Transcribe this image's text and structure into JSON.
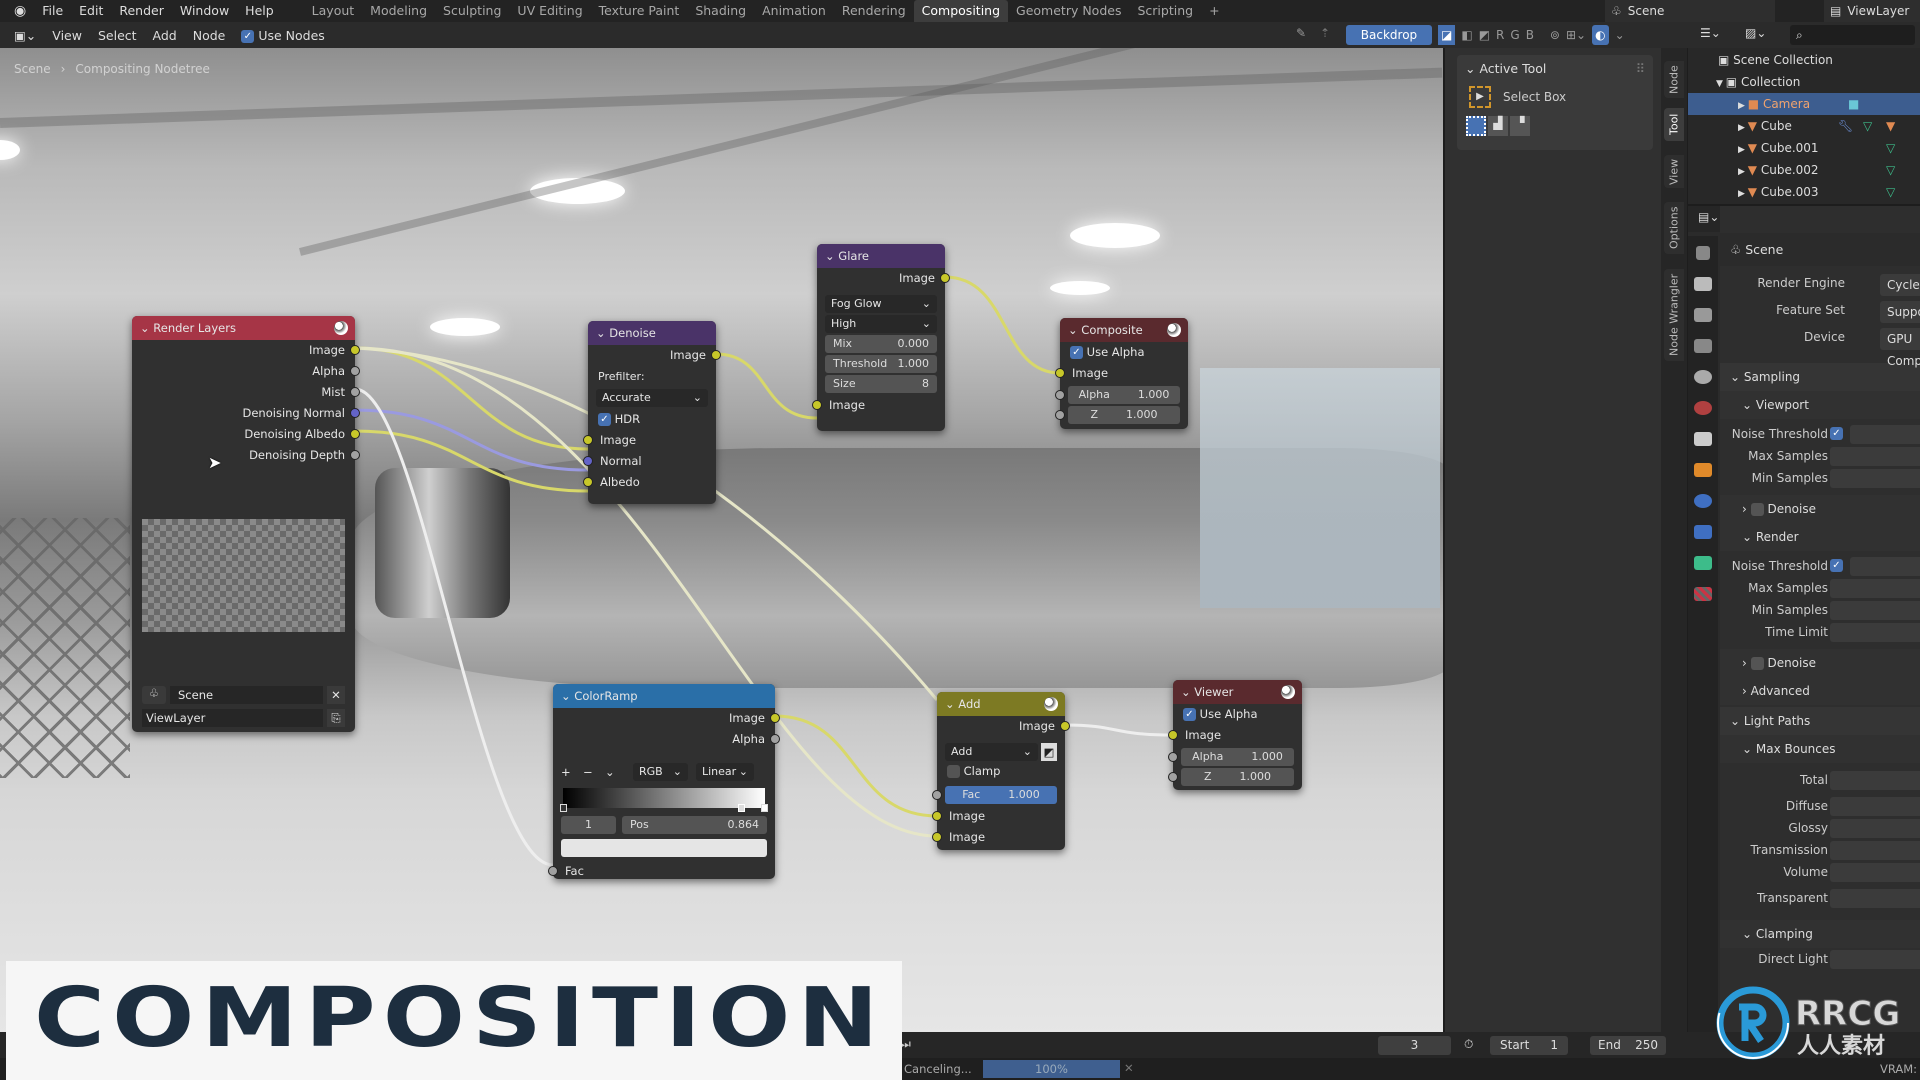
{
  "topbar": {
    "menus": [
      "File",
      "Edit",
      "Render",
      "Window",
      "Help"
    ],
    "workspaces": [
      "Layout",
      "Modeling",
      "Sculpting",
      "UV Editing",
      "Texture Paint",
      "Shading",
      "Animation",
      "Rendering",
      "Compositing",
      "Geometry Nodes",
      "Scripting",
      "+"
    ],
    "active_workspace": "Compositing",
    "scene": "Scene",
    "view_layer": "ViewLayer"
  },
  "header": {
    "menus": [
      "View",
      "Select",
      "Add",
      "Node"
    ],
    "use_nodes": "Use Nodes",
    "use_nodes_checked": true,
    "backdrop": "Backdrop",
    "channels": [
      "R",
      "G",
      "B"
    ]
  },
  "breadcrumb": [
    "Scene",
    "Compositing Nodetree"
  ],
  "nodes": {
    "render_layers": {
      "title": "Render Layers",
      "outputs": [
        "Image",
        "Alpha",
        "Mist",
        "Denoising Normal",
        "Denoising Albedo",
        "Denoising Depth"
      ],
      "scene": "Scene",
      "view_layer": "ViewLayer",
      "color": "#a63546"
    },
    "denoise": {
      "title": "Denoise",
      "output": "Image",
      "prefilter_label": "Prefilter:",
      "prefilter": "Accurate",
      "hdr": "HDR",
      "hdr_checked": true,
      "inputs": [
        "Image",
        "Normal",
        "Albedo"
      ],
      "color": "#4a3368"
    },
    "glare": {
      "title": "Glare",
      "output": "Image",
      "type": "Fog Glow",
      "quality": "High",
      "mix_label": "Mix",
      "mix": "0.000",
      "threshold_label": "Threshold",
      "threshold": "1.000",
      "size_label": "Size",
      "size": "8",
      "input": "Image",
      "color": "#4a3368"
    },
    "composite": {
      "title": "Composite",
      "use_alpha": "Use Alpha",
      "input": "Image",
      "alpha_label": "Alpha",
      "alpha": "1.000",
      "z_label": "Z",
      "z": "1.000",
      "color": "#5a2a2e"
    },
    "colorramp": {
      "title": "ColorRamp",
      "outputs": [
        "Image",
        "Alpha"
      ],
      "plus": "+",
      "minus": "−",
      "mode": "RGB",
      "interp": "Linear",
      "index": "1",
      "pos_label": "Pos",
      "pos": "0.864",
      "input": "Fac",
      "color": "#2a6fa8"
    },
    "add": {
      "title": "Add",
      "output": "Image",
      "blend": "Add",
      "clamp": "Clamp",
      "fac_label": "Fac",
      "fac": "1.000",
      "inputs": [
        "Image",
        "Image"
      ],
      "color": "#7d7a23"
    },
    "viewer": {
      "title": "Viewer",
      "use_alpha": "Use Alpha",
      "input": "Image",
      "alpha_label": "Alpha",
      "alpha": "1.000",
      "z_label": "Z",
      "z": "1.000",
      "color": "#5a2a2e"
    }
  },
  "sidebar": {
    "panel": "Active Tool",
    "tool": "Select Box",
    "tabs": [
      "Node",
      "Tool",
      "View",
      "Options",
      "Node Wrangler"
    ],
    "active_tab": "Tool"
  },
  "outliner": {
    "items": [
      {
        "name": "Scene Collection",
        "level": 0
      },
      {
        "name": "Collection",
        "level": 1
      },
      {
        "name": "Camera",
        "level": 2,
        "selected": true
      },
      {
        "name": "Cube",
        "level": 2
      },
      {
        "name": "Cube.001",
        "level": 2
      },
      {
        "name": "Cube.002",
        "level": 2
      },
      {
        "name": "Cube.003",
        "level": 2
      }
    ]
  },
  "properties": {
    "context": "Scene",
    "render_engine": {
      "label": "Render Engine",
      "value": "Cycles"
    },
    "feature_set": {
      "label": "Feature Set",
      "value": "Supported"
    },
    "device": {
      "label": "Device",
      "value": "GPU Comp"
    },
    "sampling": "Sampling",
    "viewport": "Viewport",
    "render": "Render",
    "noise_threshold": "Noise Threshold",
    "max_samples": "Max Samples",
    "min_samples": "Min Samples",
    "time_limit": "Time Limit",
    "denoise": "Denoise",
    "advanced": "Advanced",
    "light_paths": "Light Paths",
    "max_bounces": "Max Bounces",
    "bounces": [
      "Total",
      "Diffuse",
      "Glossy",
      "Transmission",
      "Volume"
    ],
    "transparent": "Transparent",
    "clamping": "Clamping",
    "direct_light": "Direct Light"
  },
  "timeline": {
    "current_frame": "3",
    "start_label": "Start",
    "start": "1",
    "end_label": "End",
    "end": "250"
  },
  "status": {
    "text": "Canceling...",
    "progress_label": "100%",
    "progress": 100,
    "vram": "VRAM:"
  },
  "overlay": {
    "title": "COMPOSITION",
    "watermark": "RRCG 人人素材"
  },
  "colors": {
    "accent": "#4772b3",
    "socket_color": "#c7c729",
    "socket_vector": "#6363c7"
  }
}
